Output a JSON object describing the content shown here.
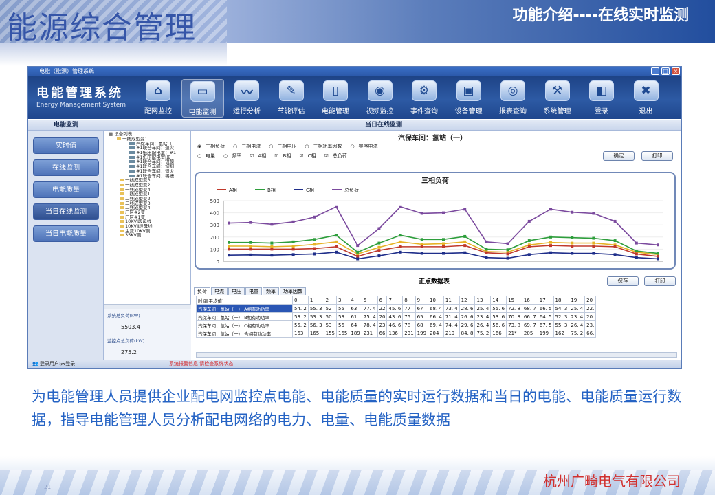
{
  "slide": {
    "title_left": "能源综合管理",
    "title_right": "功能介绍----在线实时监测",
    "caption": "为电能管理人员提供企业配电网监控点电能、电能质量的实时运行数据和当日的电能、电能质量运行数据，指导电能管理人员分析配电网络的电力、电量、电能质量数据",
    "company": "杭州广畸电气有限公司",
    "page_number": "21"
  },
  "window": {
    "title": "电能（能源）管理系统",
    "logo_cn": "电能管理系统",
    "logo_en": "Energy Management System"
  },
  "toolbar": {
    "items": [
      {
        "label": "配网监控",
        "icon": "home-icon",
        "glyph": "⌂"
      },
      {
        "label": "电能监测",
        "icon": "monitor-icon",
        "glyph": "▭"
      },
      {
        "label": "运行分析",
        "icon": "chart-icon",
        "glyph": "〰"
      },
      {
        "label": "节能评估",
        "icon": "pen-icon",
        "glyph": "✎"
      },
      {
        "label": "电能管理",
        "icon": "meter-icon",
        "glyph": "▯"
      },
      {
        "label": "视频监控",
        "icon": "camera-icon",
        "glyph": "◉"
      },
      {
        "label": "事件查询",
        "icon": "search-icon",
        "glyph": "⚙"
      },
      {
        "label": "设备管理",
        "icon": "printer-icon",
        "glyph": "▣"
      },
      {
        "label": "报表查询",
        "icon": "report-icon",
        "glyph": "◎"
      },
      {
        "label": "系统管理",
        "icon": "settings-icon",
        "glyph": "⚒"
      },
      {
        "label": "登录",
        "icon": "login-icon",
        "glyph": "◧"
      },
      {
        "label": "退出",
        "icon": "exit-icon",
        "glyph": "✖"
      }
    ],
    "active_index": 1
  },
  "header": {
    "left": "电能监测",
    "center": "当日在线监测"
  },
  "leftnav": {
    "items": [
      "实时值",
      "在线监测",
      "电能质量",
      "当日在线监测",
      "当日电能质量"
    ],
    "active_index": 3
  },
  "tree": {
    "root": "设备列表",
    "nodes": [
      {
        "text": "一线成型变1",
        "type": "folder"
      },
      {
        "text": "汽保车间：氢站（",
        "type": "dev"
      },
      {
        "text": "#1联合车间：退火",
        "type": "dev"
      },
      {
        "text": "#1低压配电室：#1",
        "type": "dev"
      },
      {
        "text": "#1低压配电室Ⅰ母",
        "type": "dev"
      },
      {
        "text": "#1联合车间：镀膜",
        "type": "dev"
      },
      {
        "text": "#1联合车间：切割",
        "type": "dev"
      },
      {
        "text": "#1联合车间：退火",
        "type": "dev"
      },
      {
        "text": "#1联合车间：锡槽",
        "type": "dev"
      },
      {
        "text": "一线成型变3",
        "type": "folder"
      },
      {
        "text": "一线成型变2",
        "type": "folder"
      },
      {
        "text": "一线成型变4",
        "type": "folder"
      },
      {
        "text": "二线成型变1",
        "type": "folder"
      },
      {
        "text": "二线成型变2",
        "type": "folder"
      },
      {
        "text": "二线成型变3",
        "type": "folder"
      },
      {
        "text": "二线成型变4",
        "type": "folder"
      },
      {
        "text": "厂区#2变",
        "type": "folder"
      },
      {
        "text": "厂区#1变",
        "type": "folder"
      },
      {
        "text": "10KVⅠ段母线",
        "type": "folder"
      },
      {
        "text": "10KVⅡ段母线",
        "type": "folder"
      },
      {
        "text": "主变10KV侧",
        "type": "folder"
      },
      {
        "text": "35KV侧",
        "type": "folder"
      }
    ]
  },
  "summary": {
    "total_label": "系统总负荷(kW)",
    "total_value": "5503.4",
    "point_label": "监控点总负荷(kW)",
    "point_value": "275.2"
  },
  "main": {
    "subtitle": "汽保车间：氢站（一）",
    "radio_options": [
      "三相负荷",
      "三相电流",
      "三相电压",
      "三相功率因数",
      "零序电流"
    ],
    "radio_selected": 0,
    "row2_options": [
      {
        "label": "电量",
        "kind": "radio",
        "checked": false
      },
      {
        "label": "频率",
        "kind": "radio",
        "checked": false
      },
      {
        "label": "A相",
        "kind": "check",
        "checked": true
      },
      {
        "label": "B相",
        "kind": "check",
        "checked": true
      },
      {
        "label": "C相",
        "kind": "check",
        "checked": true
      },
      {
        "label": "总负荷",
        "kind": "check",
        "checked": true
      }
    ],
    "confirm_label": "确定",
    "print_label": "打印",
    "table_title": "正点数据表",
    "save_label": "保存",
    "print2_label": "打印",
    "tabs": [
      "负荷",
      "电流",
      "电压",
      "电量",
      "频率",
      "功率因数"
    ],
    "table_header_label": "时间[平均值]",
    "hours": [
      "0",
      "1",
      "2",
      "3",
      "4",
      "5",
      "6",
      "7",
      "8",
      "9",
      "10",
      "11",
      "12",
      "13",
      "14",
      "15",
      "16",
      "17",
      "18",
      "19",
      "20"
    ],
    "rows": [
      {
        "name": "汽保车间：氢站（一） A相有功功率",
        "values": [
          "54. 2",
          "55. 3",
          "52",
          "55",
          "63",
          "77. 4",
          "22",
          "45. 6",
          "77",
          "67",
          "68. 4",
          "73. 4",
          "28. 6",
          "25. 4",
          "55. 6",
          "72. 8",
          "68. 7",
          "66. 5",
          "54. 3",
          "25. 4",
          "22."
        ]
      },
      {
        "name": "汽保车间：氢站（一） B相有功功率",
        "values": [
          "53. 2",
          "53. 3",
          "50",
          "53",
          "61",
          "75. 4",
          "20",
          "43. 6",
          "75",
          "65",
          "66. 4",
          "71. 4",
          "26. 6",
          "23. 4",
          "53. 6",
          "70. 8",
          "66. 7",
          "64. 5",
          "52. 3",
          "23. 4",
          "20."
        ]
      },
      {
        "name": "汽保车间：氢站（一） C相有功功率",
        "values": [
          "55. 2",
          "56. 3",
          "53",
          "56",
          "64",
          "78. 4",
          "23",
          "46. 6",
          "78",
          "68",
          "69. 4",
          "74. 4",
          "29. 6",
          "26. 4",
          "56. 6",
          "73. 8",
          "69. 7",
          "67. 5",
          "55. 3",
          "26. 4",
          "23."
        ]
      },
      {
        "name": "汽保车间：氢站（一） 合相有功功率",
        "values": [
          "163",
          "165",
          "155",
          "165",
          "189",
          "231",
          "66",
          "136",
          "231",
          "199",
          "204",
          "219",
          "84. 8",
          "75. 2",
          "166",
          "21*",
          "205",
          "199",
          "162",
          "75. 2",
          "66."
        ]
      }
    ]
  },
  "status": {
    "user": "登录用户:未登录",
    "warning": "系统报警信息 请检查系统状态"
  },
  "chart_data": {
    "type": "line",
    "title": "三相负荷",
    "ylim": [
      0,
      500
    ],
    "yticks": [
      0,
      100,
      200,
      300,
      400,
      500
    ],
    "points": 24,
    "series": [
      {
        "name": "A相",
        "color": "#c0392b",
        "values": [
          100,
          100,
          100,
          100,
          105,
          120,
          40,
          90,
          120,
          120,
          120,
          130,
          70,
          60,
          120,
          130,
          125,
          125,
          120,
          60,
          40
        ]
      },
      {
        "name": "B相",
        "color": "#2e9e3c",
        "values": [
          155,
          155,
          150,
          160,
          180,
          215,
          75,
          150,
          215,
          180,
          180,
          205,
          100,
          95,
          170,
          200,
          195,
          190,
          170,
          85,
          65
        ]
      },
      {
        "name": "C相",
        "color": "#1f2e8a",
        "values": [
          50,
          52,
          50,
          55,
          60,
          75,
          20,
          45,
          75,
          65,
          65,
          70,
          30,
          25,
          55,
          70,
          65,
          65,
          55,
          30,
          20
        ]
      },
      {
        "name": "总负荷",
        "color": "#7b4a9e",
        "values": [
          315,
          320,
          305,
          325,
          365,
          450,
          130,
          270,
          450,
          395,
          400,
          430,
          160,
          145,
          330,
          430,
          405,
          395,
          330,
          150,
          135
        ]
      }
    ],
    "extra_yellow": {
      "name": "",
      "color": "#e6b325",
      "values": [
        125,
        125,
        120,
        125,
        140,
        160,
        60,
        115,
        160,
        140,
        145,
        160,
        80,
        75,
        135,
        155,
        150,
        150,
        135,
        75,
        55
      ]
    }
  }
}
